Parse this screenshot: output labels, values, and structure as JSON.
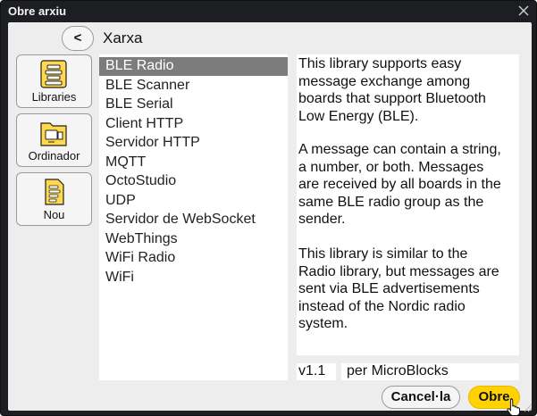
{
  "window": {
    "title": "Obre arxiu"
  },
  "nav": {
    "back_label": "<",
    "path": "Xarxa"
  },
  "sidebar": {
    "items": [
      {
        "label": "Libraries",
        "icon": "libraries-icon"
      },
      {
        "label": "Ordinador",
        "icon": "computer-folder-icon"
      },
      {
        "label": "Nou",
        "icon": "new-file-icon"
      }
    ]
  },
  "files": {
    "selected": "BLE Radio",
    "items": [
      "BLE Radio",
      "BLE Scanner",
      "BLE Serial",
      "Client HTTP",
      "Servidor HTTP",
      "MQTT",
      "OctoStudio",
      "UDP",
      "Servidor de WebSocket",
      "WebThings",
      "WiFi Radio",
      "WiFi"
    ]
  },
  "description": {
    "lines_p1": [
      "This library supports easy",
      "message exchange among",
      "boards that support Bluetooth",
      "Low Energy (BLE)."
    ],
    "lines_p2": [
      "A message can contain a string,",
      "a number, or both. Messages",
      "are received by all boards in the",
      "same BLE radio group as the",
      "sender."
    ],
    "lines_p3": [
      "This library is similar to the",
      "Radio library, but messages are",
      "sent via BLE advertisements",
      "instead of the Nordic radio",
      "system."
    ]
  },
  "meta": {
    "version": "v1.1",
    "author": "per MicroBlocks"
  },
  "buttons": {
    "cancel_label": "Cancel·la",
    "open_label": "Obre"
  },
  "colors": {
    "accent": "#ffd200",
    "selection": "#7c7c7c",
    "titlebar": "#1c1e22"
  }
}
